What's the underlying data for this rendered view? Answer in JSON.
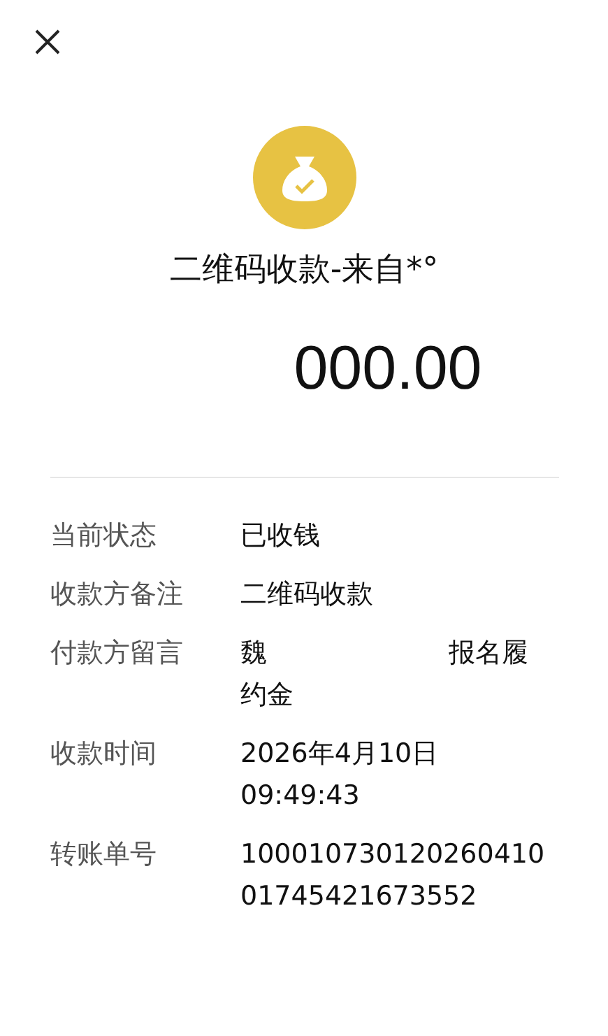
{
  "title": "二维码收款-来自*°",
  "amount": "000.00",
  "details": [
    {
      "label": "当前状态",
      "value": [
        "已收钱"
      ]
    },
    {
      "label": "收款方备注",
      "value": [
        "二维码收款"
      ]
    },
    {
      "label": "付款方留言",
      "value": [
        "魏",
        "报名履约金"
      ]
    },
    {
      "label": "收款时间",
      "value": [
        "2026年4月10日\n09:49:43"
      ]
    },
    {
      "label": "转账单号",
      "value": [
        "100010730120260410 01745421673552"
      ]
    }
  ]
}
